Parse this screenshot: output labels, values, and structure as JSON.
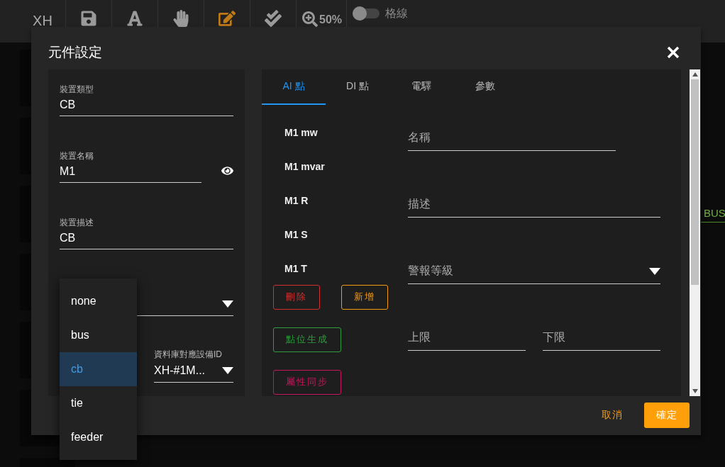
{
  "toolbar": {
    "logo": "XH",
    "tools": [
      {
        "kind": "save",
        "selected": false
      },
      {
        "kind": "text",
        "selected": false
      },
      {
        "kind": "hand",
        "selected": false
      },
      {
        "kind": "edit",
        "selected": true
      },
      {
        "kind": "check",
        "selected": false
      }
    ],
    "zoom": "50%",
    "grid_toggle": {
      "label": "格線",
      "on": false
    }
  },
  "canvas": {
    "label": "BUS"
  },
  "dialog": {
    "title": "元件設定",
    "device_fields": [
      {
        "kind": "text",
        "label": "裝置類型",
        "value": "CB"
      },
      {
        "kind": "secret",
        "label": "裝置名稱",
        "value": "M1"
      },
      {
        "kind": "text",
        "label": "裝置描述",
        "value": "CB"
      },
      {
        "kind": "select"
      },
      {
        "kind": "select",
        "label": "資料庫對應設備ID",
        "value": "XH-#1M..."
      }
    ],
    "type_menu": [
      {
        "label": "none",
        "selected": false
      },
      {
        "label": "bus",
        "selected": false
      },
      {
        "label": "cb",
        "selected": true
      },
      {
        "label": "tie",
        "selected": false
      },
      {
        "label": "feeder",
        "selected": false
      }
    ],
    "tabs": [
      {
        "label": "AI 點",
        "selected": true
      },
      {
        "label": "DI 點",
        "selected": false
      },
      {
        "label": "電驛",
        "selected": false
      },
      {
        "label": "參數",
        "selected": false
      }
    ],
    "points": [
      "M1 mw",
      "M1 mvar",
      "M1 R",
      "M1 S",
      "M1 T"
    ],
    "point_buttons": [
      {
        "label": "刪除",
        "kind": "danger"
      },
      {
        "label": "新增",
        "kind": "warning"
      },
      {
        "label": "點位生成",
        "kind": "success"
      },
      {
        "label": "屬性同步",
        "kind": "accent"
      }
    ],
    "point_form": {
      "name": {
        "placeholder": "名稱"
      },
      "description": {
        "placeholder": "描述"
      },
      "alarm_level": {
        "placeholder": "警報等級"
      },
      "upper_limit": {
        "placeholder": "上限"
      },
      "lower_limit": {
        "placeholder": "下限"
      }
    },
    "cancel": "取消",
    "confirm": "確定"
  }
}
